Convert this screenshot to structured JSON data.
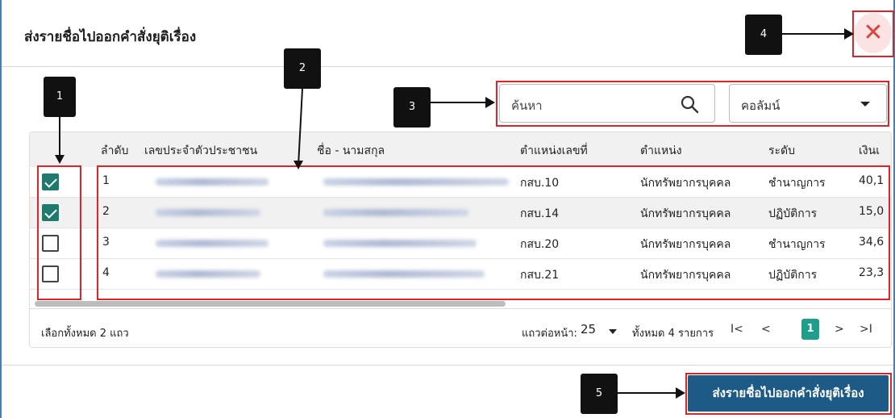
{
  "dialog": {
    "title": "ส่งรายชื่อไปออกคำสั่งยุติเรื่อง",
    "close_icon": "close-icon"
  },
  "search": {
    "placeholder": "ค้นหา",
    "icon": "search-icon"
  },
  "column_select": {
    "selected": "คอลัมน์"
  },
  "table": {
    "headers": [
      "ลำดับ",
      "เลขประจำตัวประชาชน",
      "ชื่อ - นามสกุล",
      "ตำแหน่งเลขที่",
      "ตำแหน่ง",
      "ระดับ",
      "เงินเ"
    ],
    "rows": [
      {
        "checked": true,
        "no": "1",
        "position_no": "กสบ.10",
        "position": "นักทรัพยากรบุคคล",
        "level": "ชำนาญการ",
        "salary": "40,1"
      },
      {
        "checked": true,
        "no": "2",
        "position_no": "กสบ.14",
        "position": "นักทรัพยากรบุคคล",
        "level": "ปฏิบัติการ",
        "salary": "15,0"
      },
      {
        "checked": false,
        "no": "3",
        "position_no": "กสบ.20",
        "position": "นักทรัพยากรบุคคล",
        "level": "ชำนาญการ",
        "salary": "34,6"
      },
      {
        "checked": false,
        "no": "4",
        "position_no": "กสบ.21",
        "position": "นักทรัพยากรบุคคล",
        "level": "ปฏิบัติการ",
        "salary": "23,3"
      }
    ]
  },
  "footer": {
    "selected_text": "เลือกทั้งหมด 2 แถว",
    "rows_per_page_label": "แถวต่อหน้า:",
    "rows_per_page_value": "25",
    "total_text": "ทั้งหมด 4 รายการ",
    "first": "I<",
    "prev": "<",
    "current_page": "1",
    "next": ">",
    "last": ">I"
  },
  "submit_label": "ส่งรายชื่อไปออกคำสั่งยุติเรื่อง",
  "callouts": [
    "1",
    "2",
    "3",
    "4",
    "5"
  ],
  "colors": {
    "accent": "#1f9e8c",
    "primary_button": "#1d5b86",
    "highlight": "#e0232b"
  }
}
